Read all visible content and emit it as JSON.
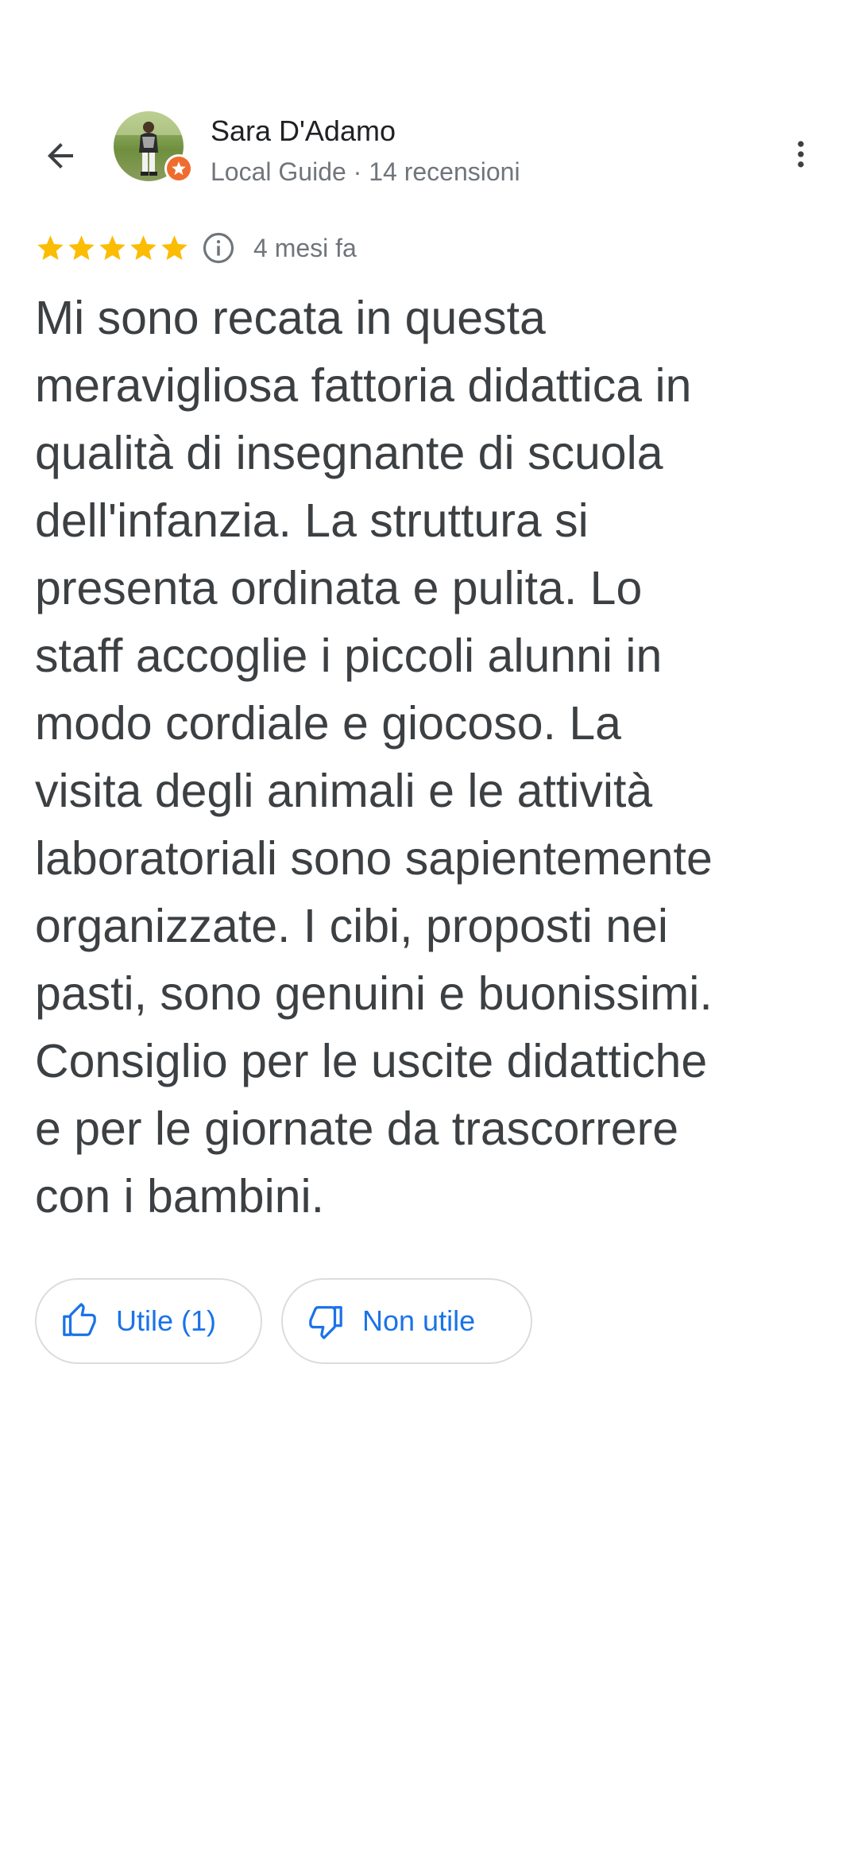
{
  "header": {
    "back_icon": "arrow-back-icon",
    "user_name": "Sara D'Adamo",
    "user_meta": "Local Guide · 14 recensioni",
    "badge_icon": "local-guide-star-icon",
    "badge_color": "#ef6c2f",
    "more_icon": "more-vert-icon"
  },
  "review": {
    "rating": 5,
    "max_rating": 5,
    "star_color": "#fbbc04",
    "time_ago": "4 mesi fa",
    "text_lines": [
      "Mi sono recata in questa",
      "meravigliosa fattoria didattica in",
      "qualità di insegnante di scuola",
      "dell'infanzia. La struttura si",
      "presenta ordinata e pulita. Lo",
      "staff accoglie i piccoli alunni in",
      "modo cordiale e giocoso. La",
      "visita degli animali e le attività",
      "laboratoriali sono sapientemente",
      "organizzate. I cibi, proposti nei",
      "pasti, sono genuini e buonissimi.",
      "Consiglio per le uscite didattiche",
      "e per le giornate da trascorrere",
      "con i bambini."
    ]
  },
  "actions": {
    "helpful_label": "Utile (1)",
    "unhelpful_label": "Non utile",
    "accent_color": "#1a73e8"
  }
}
